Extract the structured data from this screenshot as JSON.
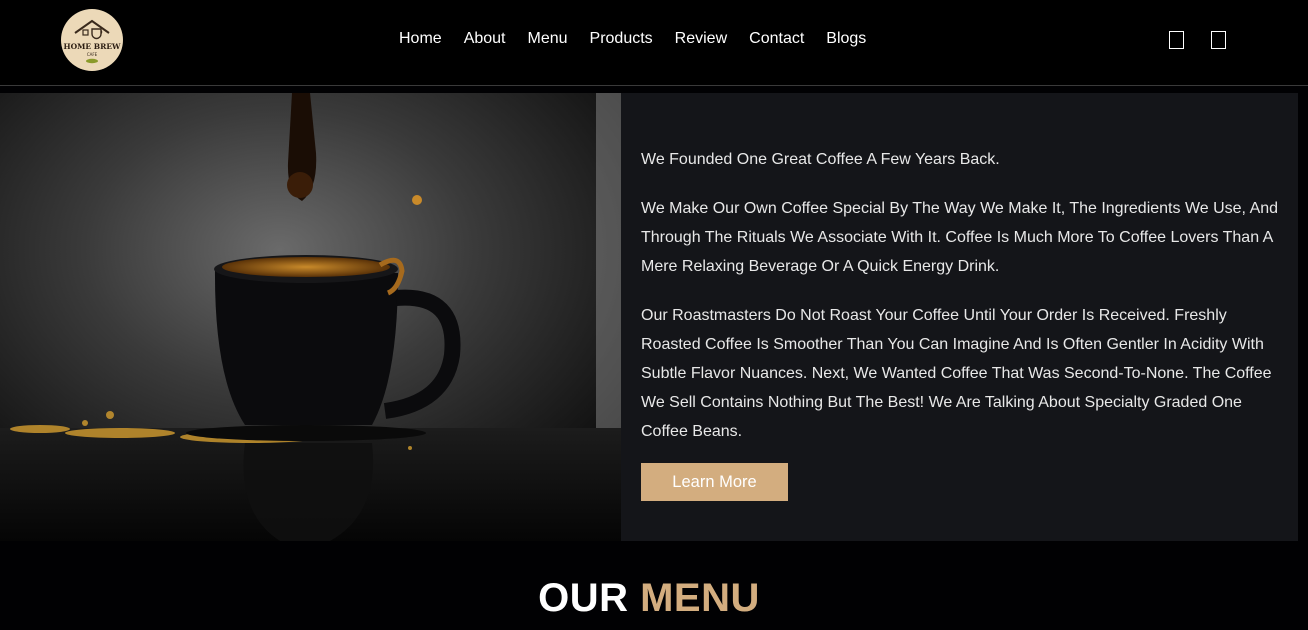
{
  "logo": {
    "line1": "HOME BREW",
    "line2": "CAFE"
  },
  "nav": {
    "items": [
      {
        "label": "Home"
      },
      {
        "label": "About"
      },
      {
        "label": "Menu"
      },
      {
        "label": "Products"
      },
      {
        "label": "Review"
      },
      {
        "label": "Contact"
      },
      {
        "label": "Blogs"
      }
    ]
  },
  "header_icons": [
    "search-icon",
    "cart-icon"
  ],
  "about": {
    "paragraphs": [
      "We Founded One Great Coffee A Few Years Back.",
      "We Make Our Own Coffee Special By The Way We Make It, The Ingredients We Use, And Through The Rituals We Associate With It. Coffee Is Much More To Coffee Lovers Than A Mere Relaxing Beverage Or A Quick Energy Drink.",
      "Our Roastmasters Do Not Roast Your Coffee Until Your Order Is Received. Freshly Roasted Coffee Is Smoother Than You Can Imagine And Is Often Gentler In Acidity With Subtle Flavor Nuances. Next, We Wanted Coffee That Was Second-To-None. The Coffee We Sell Contains Nothing But The Best! We Are Talking About Specialty Graded One Coffee Beans."
    ],
    "button_label": "Learn More"
  },
  "section_heading": {
    "part1": "OUR",
    "part2": "MENU"
  },
  "colors": {
    "accent": "#d3ad7f",
    "background": "#010103",
    "panel": "#141519"
  }
}
